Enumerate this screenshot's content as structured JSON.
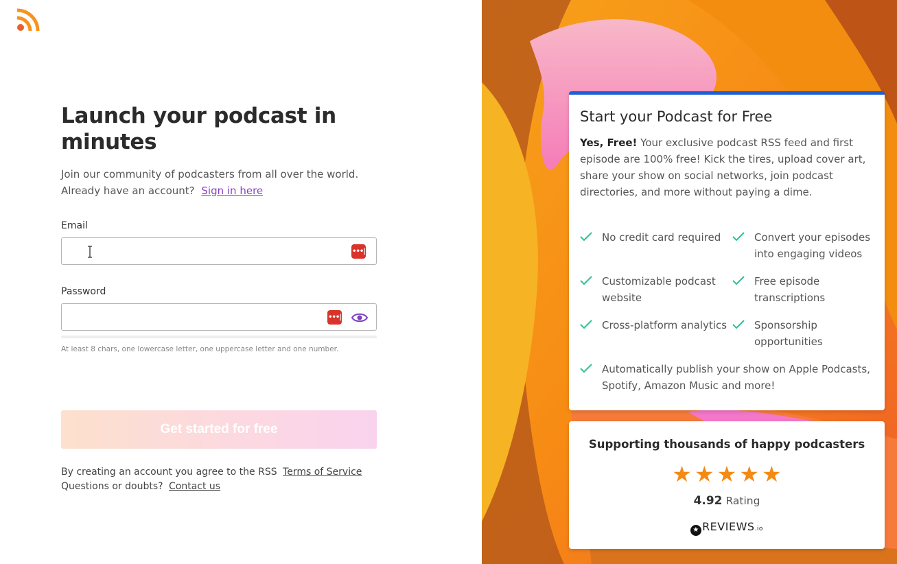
{
  "header": {
    "logo_icon": "rss-feed-icon"
  },
  "signup": {
    "title": "Launch your podcast in minutes",
    "subtitle": "Join our community of podcasters from all over the world.",
    "account_prompt": "Already have an account?",
    "sign_in_link": "Sign in here",
    "email_label": "Email",
    "email_value": "",
    "password_label": "Password",
    "password_value": "",
    "password_manager_icon": "password-manager-icon",
    "show_password_icon": "eye-icon",
    "password_hint": "At least 8 chars, one lowercase letter, one uppercase letter and one number.",
    "submit_label": "Get started for free",
    "terms_text": "By creating an account you agree to the RSS",
    "terms_link": "Terms of Service",
    "questions_text": "Questions or doubts?",
    "contact_link": "Contact us"
  },
  "promo": {
    "title": "Start your Podcast for Free",
    "lead_bold": "Yes, Free!",
    "lead_text": " Your exclusive podcast RSS feed and first episode are 100% free! Kick the tires, upload cover art, share your show on social networks, join podcast directories, and more without paying a dime.",
    "features": [
      "No credit card required",
      "Convert your episodes into engaging videos",
      "Customizable podcast website",
      "Free episode transcriptions",
      "Cross-platform analytics",
      "Sponsorship opportunities",
      "Automatically publish your show on Apple Podcasts, Spotify, Amazon Music and more!"
    ]
  },
  "reviews": {
    "title": "Supporting thousands of happy podcasters",
    "stars": 5,
    "rating_value": "4.92",
    "rating_label": "Rating",
    "brand": "REVIEWS",
    "brand_suffix": ".io"
  },
  "colors": {
    "accent_blue": "#1f5fd6",
    "link_purple": "#8a3fc7",
    "check_green": "#2bc48a",
    "star_orange": "#f48a14"
  }
}
